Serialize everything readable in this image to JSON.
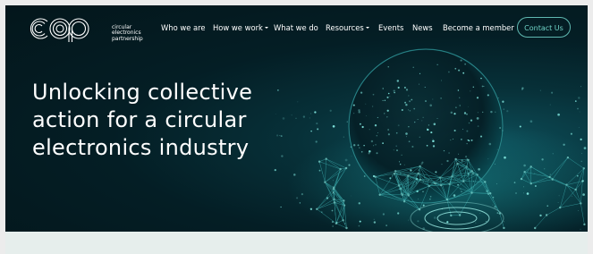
{
  "brand": {
    "logo_text": "cep",
    "lines": [
      "circular",
      "electronics",
      "partnership"
    ]
  },
  "nav": {
    "items": [
      {
        "label": "Who we are",
        "dropdown": false
      },
      {
        "label": "How we work",
        "dropdown": true
      },
      {
        "label": "What we do",
        "dropdown": false
      },
      {
        "label": "Resources",
        "dropdown": true
      },
      {
        "label": "Events",
        "dropdown": false
      },
      {
        "label": "News",
        "dropdown": false
      },
      {
        "label": "Become a member",
        "dropdown": false
      }
    ],
    "cta": "Contact Us"
  },
  "hero": {
    "headline_lines": [
      "Unlocking collective",
      "action for a circular",
      "electronics industry"
    ]
  },
  "colors": {
    "background": "#03161b",
    "accent": "#6fd2c6",
    "text": "#ffffff"
  }
}
